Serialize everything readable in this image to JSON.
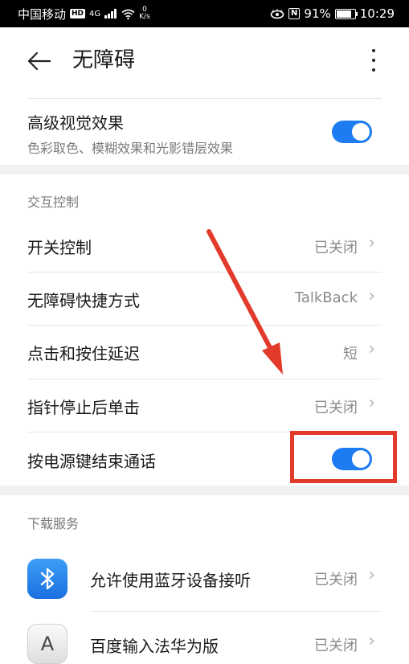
{
  "status_bar": {
    "carrier": "中国移动",
    "hd": "HD",
    "network": "4G",
    "speed_value": "0",
    "speed_unit": "K/s",
    "nfc": "N",
    "battery_percent": "91%",
    "battery_level": 0.91,
    "time": "10:29"
  },
  "header": {
    "title": "无障碍"
  },
  "advanced_visual": {
    "title": "高级视觉效果",
    "subtitle": "色彩取色、模糊效果和光影错层效果",
    "enabled": true
  },
  "interaction_section": {
    "header": "交互控制",
    "items": [
      {
        "label": "开关控制",
        "value": "已关闭"
      },
      {
        "label": "无障碍快捷方式",
        "value": "TalkBack"
      },
      {
        "label": "点击和按住延迟",
        "value": "短"
      },
      {
        "label": "指针停止后单击",
        "value": "已关闭"
      }
    ],
    "power_key": {
      "label": "按电源键结束通话",
      "enabled": true
    }
  },
  "download_section": {
    "header": "下载服务",
    "items": [
      {
        "label": "允许使用蓝牙设备接听",
        "value": "已关闭",
        "icon": "bluetooth-icon"
      },
      {
        "label": "百度输入法华为版",
        "value": "已关闭",
        "icon": "keyboard-a-icon",
        "icon_text": "A"
      }
    ]
  },
  "colors": {
    "accent": "#1e7cf2",
    "annotation": "#e23a2b"
  }
}
